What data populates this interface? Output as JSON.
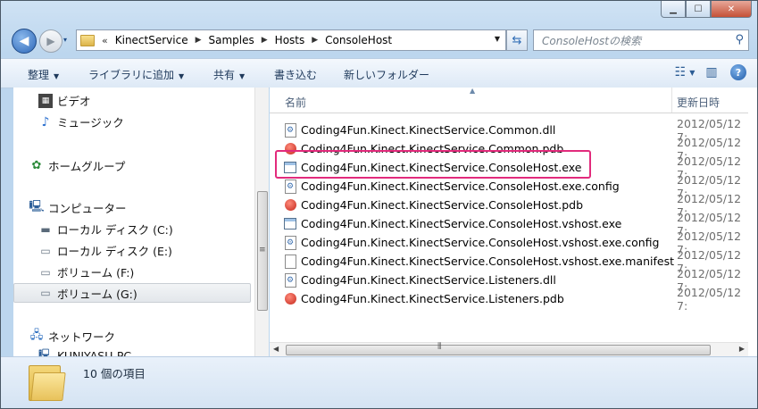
{
  "window": {
    "caption_buttons": {
      "minimize": "▁",
      "maximize": "☐",
      "close": "✕"
    }
  },
  "nav": {
    "back_icon": "◀",
    "forward_icon": "▶",
    "history_icon": "▾",
    "breadcrumb_prefix": "«",
    "breadcrumbs": [
      "KinectService",
      "Samples",
      "Hosts",
      "ConsoleHost"
    ],
    "search_placeholder": "ConsoleHostの検索"
  },
  "toolbar": {
    "organize": "整理",
    "include_library": "ライブラリに追加",
    "share": "共有",
    "burn": "書き込む",
    "new_folder": "新しいフォルダー"
  },
  "sidebar": {
    "items": [
      {
        "label": "ビデオ",
        "icon": "video-icon"
      },
      {
        "label": "ミュージック",
        "icon": "music-icon"
      },
      {
        "label": "ホームグループ",
        "icon": "homegroup-icon"
      },
      {
        "label": "コンピューター",
        "icon": "computer-icon"
      },
      {
        "label": "ローカル ディスク (C:)",
        "icon": "local-disk-icon"
      },
      {
        "label": "ローカル ディスク (E:)",
        "icon": "disk-drive-icon"
      },
      {
        "label": "ボリューム (F:)",
        "icon": "disk-drive-icon"
      },
      {
        "label": "ボリューム (G:)",
        "icon": "disk-drive-icon"
      },
      {
        "label": "ネットワーク",
        "icon": "network-icon"
      },
      {
        "label": "KUNIYASU-PC",
        "icon": "pc-icon"
      }
    ],
    "selected_index": 7
  },
  "columns": {
    "name": "名前",
    "date": "更新日時"
  },
  "files": [
    {
      "name": "Coding4Fun.Kinect.KinectService.Common.dll",
      "date": "2012/05/12 7:",
      "type": "dll"
    },
    {
      "name": "Coding4Fun.Kinect.KinectService.Common.pdb",
      "date": "2012/05/12 7:",
      "type": "pdb"
    },
    {
      "name": "Coding4Fun.Kinect.KinectService.ConsoleHost.exe",
      "date": "2012/05/12 7:",
      "type": "exe"
    },
    {
      "name": "Coding4Fun.Kinect.KinectService.ConsoleHost.exe.config",
      "date": "2012/05/12 7:",
      "type": "cfg"
    },
    {
      "name": "Coding4Fun.Kinect.KinectService.ConsoleHost.pdb",
      "date": "2012/05/12 7:",
      "type": "pdb"
    },
    {
      "name": "Coding4Fun.Kinect.KinectService.ConsoleHost.vshost.exe",
      "date": "2012/05/12 7:",
      "type": "exe"
    },
    {
      "name": "Coding4Fun.Kinect.KinectService.ConsoleHost.vshost.exe.config",
      "date": "2012/05/12 7:",
      "type": "cfg"
    },
    {
      "name": "Coding4Fun.Kinect.KinectService.ConsoleHost.vshost.exe.manifest",
      "date": "2012/05/12 7:",
      "type": "blank"
    },
    {
      "name": "Coding4Fun.Kinect.KinectService.Listeners.dll",
      "date": "2012/05/12 7:",
      "type": "dll"
    },
    {
      "name": "Coding4Fun.Kinect.KinectService.Listeners.pdb",
      "date": "2012/05/12 7:",
      "type": "pdb"
    }
  ],
  "highlighted_file_index": 2,
  "colors": {
    "highlight_border": "#e22b7c"
  },
  "status": {
    "item_count": "10 個の項目"
  }
}
